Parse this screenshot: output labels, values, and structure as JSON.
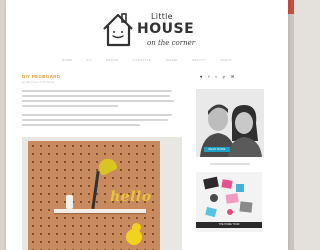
{
  "header": {
    "logo": {
      "line1": "Little",
      "line2": "HOUSE",
      "line3": "on the corner"
    }
  },
  "nav": {
    "items": [
      "HOME",
      "DIY",
      "DECOR",
      "LIFESTYLE",
      "TRAVEL",
      "BEAUTY",
      "ABOUT"
    ]
  },
  "post": {
    "title": "DIY PEGBOARD",
    "meta": "by Little House on the Corner"
  },
  "sidebar": {
    "social_icons": [
      "instagram-icon",
      "facebook-icon",
      "twitter-icon",
      "pinterest-icon",
      "email-icon"
    ],
    "about_button": "READ MORE",
    "promo_caption": "THE HOME TOUR"
  },
  "colors": {
    "accent": "#e89b2c",
    "button": "#1c9fc4",
    "pegboard": "#c98a5d"
  }
}
